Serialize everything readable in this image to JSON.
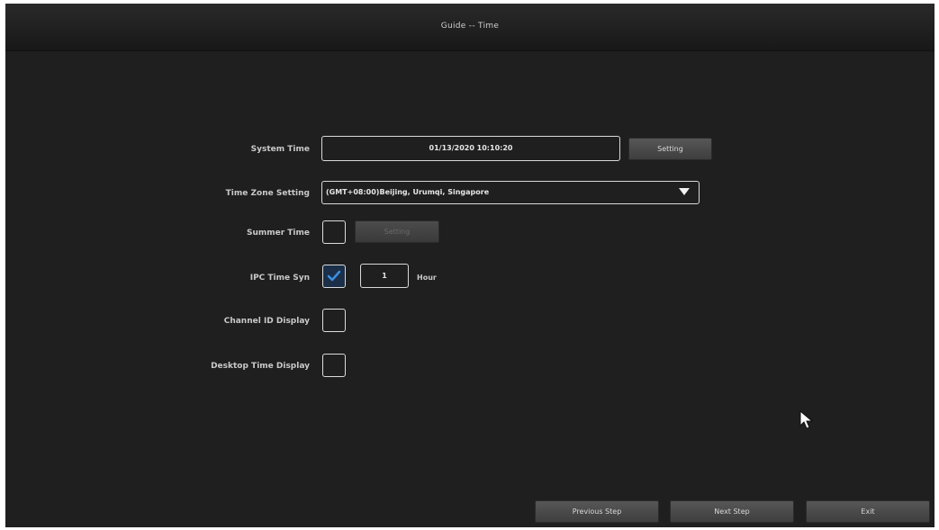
{
  "window": {
    "title": "Guide -- Time"
  },
  "form": {
    "system_time": {
      "label": "System Time",
      "value": "01/13/2020 10:10:20",
      "button_label": "Setting"
    },
    "time_zone": {
      "label": "Time Zone Setting",
      "selected": "(GMT+08:00)Beijing, Urumqi, Singapore"
    },
    "summer_time": {
      "label": "Summer Time",
      "checked": false,
      "button_label": "Setting",
      "button_disabled": true
    },
    "ipc_time_sync": {
      "label": "IPC Time Syn",
      "checked": true,
      "value": "1",
      "unit": "Hour"
    },
    "channel_id_display": {
      "label": "Channel ID Display",
      "checked": false
    },
    "desktop_time_display": {
      "label": "Desktop Time Display",
      "checked": false
    }
  },
  "footer": {
    "previous_label": "Previous Step",
    "next_label": "Next Step",
    "exit_label": "Exit"
  },
  "colors": {
    "background": "#1f1f1f",
    "titlebar": "#1c1c1c",
    "check_accent": "#3d8fe0",
    "field_border": "#d9d9d9"
  },
  "icons": {
    "check": "check-icon",
    "dropdown": "chevron-down-icon",
    "cursor": "mouse-pointer-icon"
  }
}
